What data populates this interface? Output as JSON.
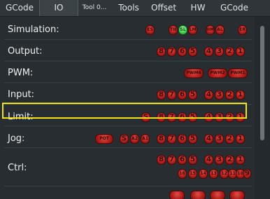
{
  "tabs": [
    {
      "label": "GCode"
    },
    {
      "label": "IO",
      "active": true
    },
    {
      "label": "Tool 0..."
    },
    {
      "label": "Tools"
    },
    {
      "label": "Offset"
    },
    {
      "label": "HW"
    },
    {
      "label": "GCode"
    }
  ],
  "rows": {
    "simulation": {
      "label": "Simulation:",
      "leds": [
        "ES",
        "TH",
        "SL",
        "LM",
        "HM",
        "AL",
        "ER"
      ],
      "active": "SL"
    },
    "output": {
      "label": "Output:",
      "leds": [
        "8",
        "7",
        "6",
        "5",
        "4",
        "3",
        "2",
        "1"
      ]
    },
    "pwm": {
      "label": "PWM:",
      "leds": [
        "PWM6",
        "PWM2",
        "PWM1"
      ]
    },
    "input": {
      "label": "Input:",
      "leds": [
        "8",
        "7",
        "6",
        "5",
        "4",
        "3",
        "2",
        "1"
      ]
    },
    "limit": {
      "label": "Limit:",
      "leds": [
        "S",
        "8",
        "7",
        "6",
        "5",
        "4",
        "3",
        "2",
        "1"
      ]
    },
    "jog": {
      "label": "Jog:",
      "leds": [
        "POT",
        "S",
        "A2",
        "A1",
        "8",
        "7",
        "6",
        "5",
        "4",
        "3",
        "2",
        "1"
      ]
    },
    "ctrl": {
      "label": "Ctrl:",
      "leds_top": [
        "8",
        "7",
        "6",
        "5",
        "4",
        "3",
        "2",
        "1"
      ],
      "leds_bottom": [
        "16",
        "15",
        "14",
        "13",
        "12",
        "11",
        "10",
        "9"
      ]
    }
  },
  "highlight_color": "#f2e21a"
}
